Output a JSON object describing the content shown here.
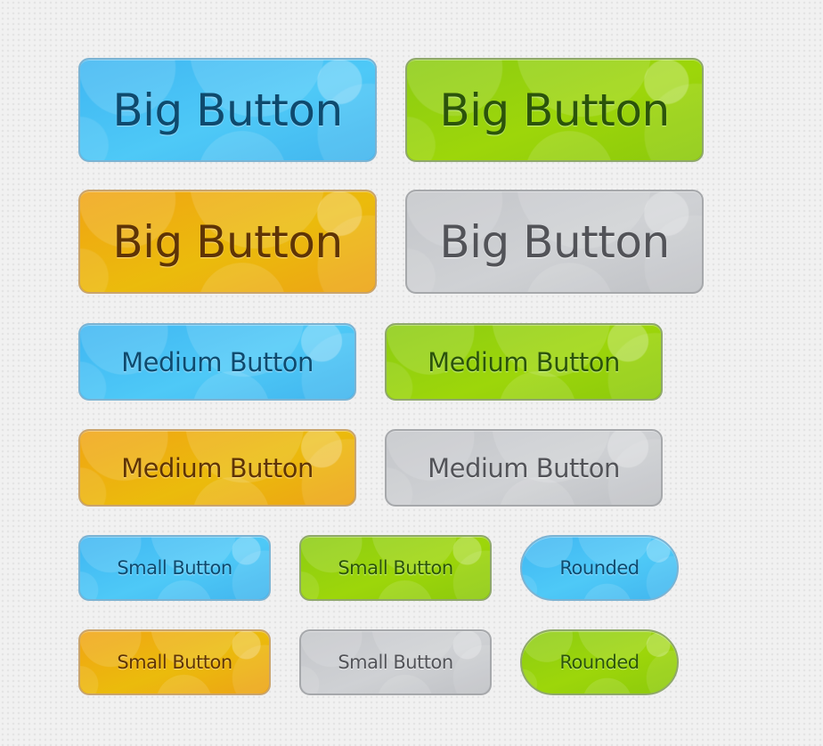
{
  "colors": {
    "blue": "#45bdf3",
    "green": "#95d00e",
    "orange": "#eeae12",
    "gray": "#c8cacd"
  },
  "big": [
    {
      "label": "Big Button",
      "color": "blue"
    },
    {
      "label": "Big Button",
      "color": "green"
    },
    {
      "label": "Big Button",
      "color": "orange"
    },
    {
      "label": "Big Button",
      "color": "gray"
    }
  ],
  "medium": [
    {
      "label": "Medium Button",
      "color": "blue"
    },
    {
      "label": "Medium Button",
      "color": "green"
    },
    {
      "label": "Medium Button",
      "color": "orange"
    },
    {
      "label": "Medium Button",
      "color": "gray"
    }
  ],
  "small": [
    {
      "label": "Small Button",
      "color": "blue"
    },
    {
      "label": "Small Button",
      "color": "green"
    },
    {
      "label": "Small Button",
      "color": "orange"
    },
    {
      "label": "Small Button",
      "color": "gray"
    }
  ],
  "rounded": [
    {
      "label": "Rounded",
      "color": "blue"
    },
    {
      "label": "Rounded",
      "color": "green"
    }
  ]
}
